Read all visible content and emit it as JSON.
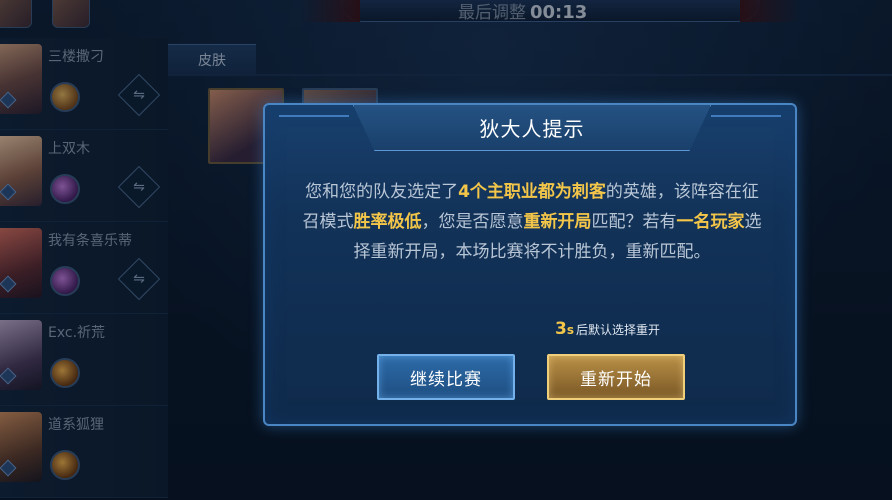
{
  "header": {
    "timer_label": "最后调整",
    "timer_value": "00:13"
  },
  "tabs": {
    "skin": "皮肤"
  },
  "players": [
    {
      "name": "三楼撒刁"
    },
    {
      "name": "上双木"
    },
    {
      "name": "我有条喜乐蒂"
    },
    {
      "name": "Exc.祈荒"
    },
    {
      "name": "道系狐狸"
    }
  ],
  "dialog": {
    "title": "狄大人提示",
    "body": [
      {
        "t": "您和您的队友选定了",
        "hl": false
      },
      {
        "t": "4个主职业都为刺客",
        "hl": true
      },
      {
        "t": "的英雄，该阵容在征召模式",
        "hl": false
      },
      {
        "t": "胜率极低",
        "hl": true
      },
      {
        "t": "，您是否愿意",
        "hl": false
      },
      {
        "t": "重新开局",
        "hl": true
      },
      {
        "t": "匹配？若有",
        "hl": false
      },
      {
        "t": "一名玩家",
        "hl": true
      },
      {
        "t": "选择重新开局，本场比赛将不计胜负，重新匹配。",
        "hl": false
      }
    ],
    "countdown_number": "3",
    "countdown_unit": "s",
    "countdown_text": "后默认选择重开",
    "continue_label": "继续比赛",
    "restart_label": "重新开始"
  },
  "colors": {
    "highlight": "#f3c64a",
    "dialog_border": "#4a86c4",
    "restart_gold": "#b99047",
    "continue_blue": "#2d6ba8"
  }
}
